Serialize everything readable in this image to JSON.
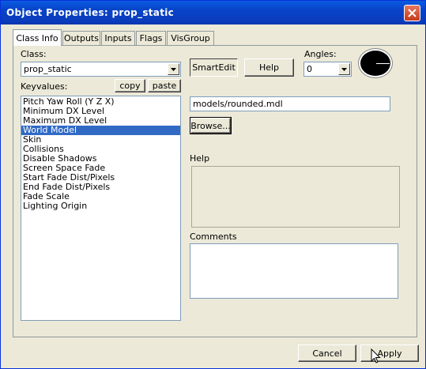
{
  "window": {
    "title": "Object Properties: prop_static"
  },
  "tabs": [
    {
      "label": "Class Info",
      "active": true
    },
    {
      "label": "Outputs",
      "active": false
    },
    {
      "label": "Inputs",
      "active": false
    },
    {
      "label": "Flags",
      "active": false
    },
    {
      "label": "VisGroup",
      "active": false
    }
  ],
  "class_section": {
    "label": "Class:",
    "value": "prop_static",
    "smartedit_label": "SmartEdit",
    "help_label": "Help"
  },
  "angles": {
    "label": "Angles:",
    "value": "0"
  },
  "keyvalues": {
    "label": "Keyvalues:",
    "copy_label": "copy",
    "paste_label": "paste",
    "items": [
      {
        "label": "Pitch Yaw Roll (Y Z X)",
        "selected": false
      },
      {
        "label": "Minimum DX Level",
        "selected": false
      },
      {
        "label": "Maximum DX Level",
        "selected": false
      },
      {
        "label": "World Model",
        "selected": true
      },
      {
        "label": "Skin",
        "selected": false
      },
      {
        "label": "Collisions",
        "selected": false
      },
      {
        "label": "Disable Shadows",
        "selected": false
      },
      {
        "label": "Screen Space Fade",
        "selected": false
      },
      {
        "label": "Start Fade Dist/Pixels",
        "selected": false
      },
      {
        "label": "End Fade Dist/Pixels",
        "selected": false
      },
      {
        "label": "Fade Scale",
        "selected": false
      },
      {
        "label": "Lighting Origin",
        "selected": false
      }
    ]
  },
  "value_field": {
    "value": "models/rounded.mdl",
    "browse_label": "Browse..."
  },
  "help_section": {
    "label": "Help",
    "text": ""
  },
  "comments_section": {
    "label": "Comments",
    "text": ""
  },
  "footer": {
    "cancel_label": "Cancel",
    "apply_label": "Apply"
  }
}
